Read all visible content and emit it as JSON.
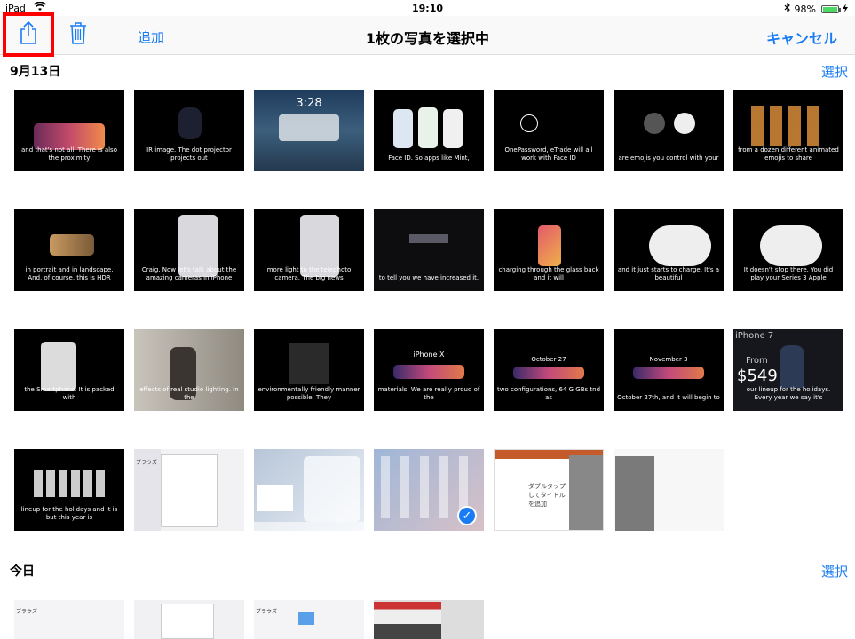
{
  "status": {
    "device": "iPad",
    "time": "19:10",
    "battery": "98%",
    "battery_level": 0.98
  },
  "navbar": {
    "add_label": "追加",
    "title": "1枚の写真を選択中",
    "cancel_label": "キャンセル"
  },
  "sections": [
    {
      "date": "9月13日",
      "select_label": "選択"
    },
    {
      "date": "今日",
      "select_label": "選択"
    }
  ],
  "photos": [
    {
      "caption": "and that's not all. There is also the proximity"
    },
    {
      "caption": "IR image.  The dot projector projects out"
    },
    {
      "caption": "3:28"
    },
    {
      "caption": "Face ID.  So apps like Mint,"
    },
    {
      "caption": "OnePassword, eTrade will all work with Face ID"
    },
    {
      "caption": "are emojis you control with your"
    },
    {
      "caption": "from a dozen different animated emojis to share"
    },
    {
      "caption": "in portrait and in landscape. And, of course, this is HDR"
    },
    {
      "caption": "Craig.  Now let's talk about the amazing cameras in iPhone"
    },
    {
      "caption": "more light to the telephoto camera.  The big news"
    },
    {
      "caption": "to tell you we have increased it."
    },
    {
      "caption": "charging through the glass back and it will"
    },
    {
      "caption": "and it just starts to charge.  It's a beautiful"
    },
    {
      "caption": "It doesn't stop there.  You did play your Series 3 Apple"
    },
    {
      "caption": "the Smartphone. It is packed with"
    },
    {
      "caption": "effects of real studio lighting. In the"
    },
    {
      "caption": "environmentally friendly manner possible.  They"
    },
    {
      "caption": "materials.  We are really proud of the"
    },
    {
      "caption": "two configurations, 64 G GBs tnd as"
    },
    {
      "caption": "October 27th, and it will begin to"
    },
    {
      "caption": "our lineup for the holidays. Every year we say it's"
    },
    {
      "caption": "lineup for the holidays and it is but this year is"
    },
    {
      "caption": "ブラウズ"
    },
    {
      "caption": ""
    },
    {
      "caption": ""
    },
    {
      "caption": "ダブルタップしてタイトルを追加"
    },
    {
      "caption": ""
    }
  ],
  "photo_labels": {
    "iphone_x": "iPhone X",
    "oct27": "October 27",
    "nov3": "November 3",
    "price": "$549",
    "from": "From",
    "iphone7": "iPhone 7"
  },
  "today_photos": [
    {
      "caption": "ブラウズ"
    },
    {
      "caption": ""
    },
    {
      "caption": "ブラウズ"
    },
    {
      "caption": ""
    }
  ]
}
